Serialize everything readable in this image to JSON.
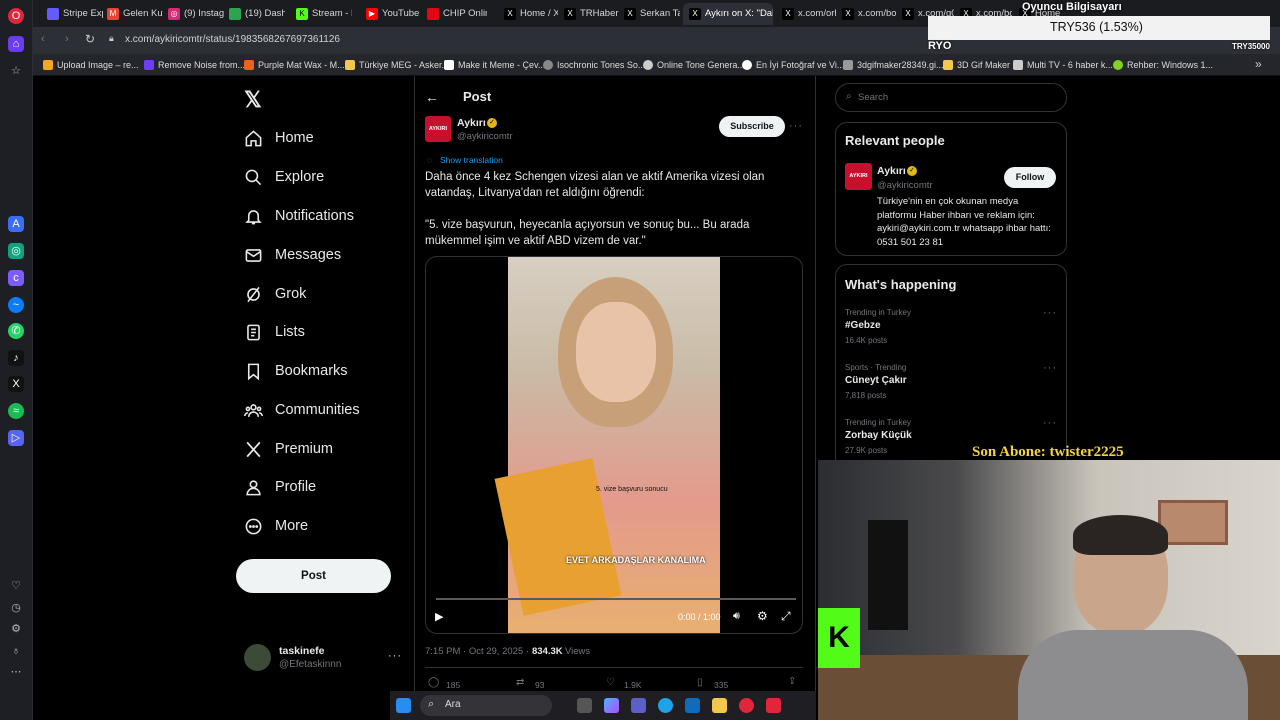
{
  "browser": {
    "tabs": [
      {
        "label": "Stripe Expr",
        "color": "#635bff"
      },
      {
        "label": "Gelen Kutu",
        "color": "#ea4335"
      },
      {
        "label": "(9) Instagra",
        "color": "#d62976"
      },
      {
        "label": "(19) Dashb",
        "color": "#2ea44f"
      },
      {
        "label": "Stream - K",
        "color": "#53fc18"
      },
      {
        "label": "YouTube",
        "color": "#ff0000"
      },
      {
        "label": "CHIP Onlin",
        "color": "#e30613"
      },
      {
        "label": "Home / X",
        "color": "#000000"
      },
      {
        "label": "TRHaber on",
        "color": "#000000"
      },
      {
        "label": "Serkan Tan",
        "color": "#000000"
      },
      {
        "label": "Aykırı on X: \"Daha",
        "color": "#000000"
      },
      {
        "label": "x.com/orhn",
        "color": "#000000"
      },
      {
        "label": "x.com/bosu",
        "color": "#000000"
      },
      {
        "label": "x.com/g0t",
        "color": "#000000"
      },
      {
        "label": "x.com/bos",
        "color": "#000000"
      },
      {
        "label": "Home",
        "color": "#000000"
      }
    ],
    "url": "x.com/aykiricomtr/status/1983568267697361126",
    "bookmarks": [
      {
        "label": "Upload Image – re...",
        "color": "#f5a623"
      },
      {
        "label": "Remove Noise from...",
        "color": "#6c3ef4"
      },
      {
        "label": "Purple Mat Wax - M...",
        "color": "#e8641b"
      },
      {
        "label": "Türkiye MEG - Asker...",
        "color": "#f2c94c"
      },
      {
        "label": "Make it Meme - Çev...",
        "color": "#ffffff"
      },
      {
        "label": "Isochronic Tones So...",
        "color": "#888888"
      },
      {
        "label": "Online Tone Genera...",
        "color": "#cccccc"
      },
      {
        "label": "En İyi Fotoğraf ve Vi...",
        "color": "#ffffff"
      },
      {
        "label": "3dgifmaker28349.gi...",
        "color": "#999999"
      },
      {
        "label": "3D Gif Maker",
        "color": "#f2c94c"
      },
      {
        "label": "Multi TV - 6 haber k...",
        "color": "#cccccc"
      },
      {
        "label": "Rehber: Windows 1...",
        "color": "#7ed321"
      }
    ]
  },
  "nav": {
    "items": [
      "Home",
      "Explore",
      "Notifications",
      "Messages",
      "Grok",
      "Lists",
      "Bookmarks",
      "Communities",
      "Premium",
      "Profile",
      "More"
    ],
    "post_button": "Post",
    "account_name": "taskinefe",
    "account_handle": "@Efetaskinnn"
  },
  "post": {
    "header": "Post",
    "author_name": "Aykırı",
    "author_handle": "@aykiricomtr",
    "avatar_text": "AYKIRI",
    "subscribe": "Subscribe",
    "show_translation": "Show translation",
    "text_1": "Daha önce 4 kez Schengen vizesi alan ve aktif Amerika vizesi olan vatandaş, Litvanya'dan ret aldığını öğrendi:",
    "text_2": "\"5. vize başvurun, heyecanla açıyorsun ve sonuç bu... Bu arada mükemmel işim ve aktif ABD vizem de var.\"",
    "video_caption_1": "5. vize başvuru sonucu",
    "video_caption_2": "EVET ARKADAŞLAR KANALIMA",
    "video_time": "0:00 / 1:00",
    "timestamp": "7:15 PM · Oct 29, 2025 ·",
    "views_count": "834.3K",
    "views_label": "Views",
    "replies": "185",
    "reposts": "93",
    "likes": "1.9K",
    "bookmarks": "335"
  },
  "sidebar": {
    "search_placeholder": "Search",
    "relevant_title": "Relevant people",
    "relevant_name": "Aykırı",
    "relevant_handle": "@aykiricomtr",
    "follow": "Follow",
    "relevant_bio": "Türkiye'nin en çok okunan medya platformu Haber ihbarı ve reklam için: aykiri@aykiri.com.tr whatsapp ihbar hattı: 0531 501 23 81",
    "happening_title": "What's happening",
    "trends": [
      {
        "context": "Trending in Turkey",
        "name": "#Gebze",
        "posts": "16.4K posts"
      },
      {
        "context": "Sports · Trending",
        "name": "Cüneyt Çakır",
        "posts": "7,818 posts"
      },
      {
        "context": "Trending in Turkey",
        "name": "Zorbay Küçük",
        "posts": "27.9K posts"
      }
    ]
  },
  "overlay": {
    "top_title": "Oyuncu Bilgisayarı",
    "price": "TRY536 (1.53%)",
    "left_tag": "RYO",
    "right_tag": "TRY35000",
    "subscriber": "Son Abone: twister2225"
  },
  "taskbar": {
    "search": "Ara"
  },
  "colors": {
    "x_blue": "#1d9bf0",
    "verified_gold": "#e2b719",
    "aykiri_red": "#c8102e",
    "subscriber_yellow": "#f5d442"
  }
}
